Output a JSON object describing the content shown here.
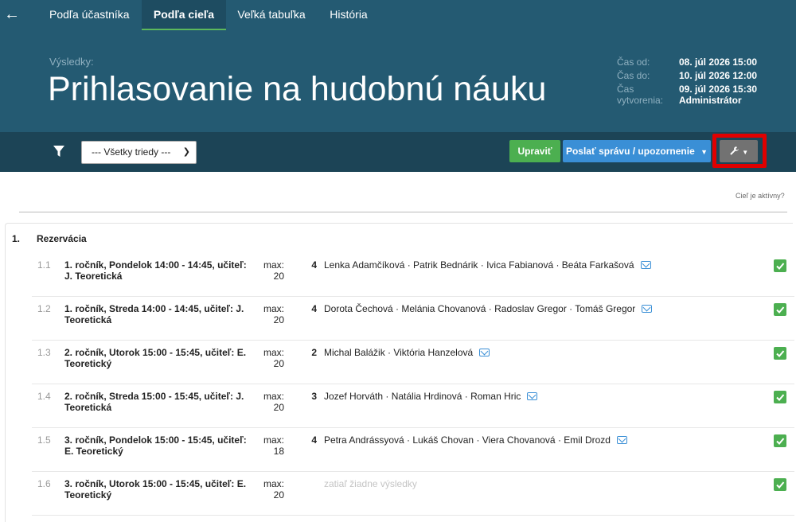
{
  "nav": {
    "back_icon": "arrow-left-icon",
    "tabs": [
      {
        "label": "Podľa účastníka"
      },
      {
        "label": "Podľa cieľa"
      },
      {
        "label": "Veľká tabuľka"
      },
      {
        "label": "História"
      }
    ]
  },
  "header": {
    "subtitle": "Výsledky:",
    "title": "Prihlasovanie na hudobnú náuku",
    "meta": {
      "from_label": "Čas od:",
      "from_value": "08. júl 2026 15:00",
      "to_label": "Čas do:",
      "to_value": "10. júl 2026 12:00",
      "created_label": "Čas vytvorenia:",
      "created_value": "09. júl 2026 15:30",
      "created_by": "Administrátor"
    }
  },
  "toolbar": {
    "filter_icon": "filter-icon",
    "class_select": "--- Všetky triedy ---",
    "edit_label": "Upraviť",
    "message_label": "Poslať správu / upozornenie",
    "tools_icon": "wrench-icon"
  },
  "main": {
    "active_link": "Cieľ je aktívny?",
    "section": {
      "num": "1.",
      "title": "Rezervácia"
    },
    "rows": [
      {
        "num": "1.1",
        "name": "1. ročník, Pondelok 14:00 - 14:45, učiteľ: J. Teoretická",
        "max_label": "max:",
        "max": "20",
        "count": "4",
        "people": "Lenka Adamčíková · Patrik Bednárik · Ivica Fabianová · Beáta Farkašová",
        "empty": ""
      },
      {
        "num": "1.2",
        "name": "1. ročník, Streda 14:00 - 14:45, učiteľ: J. Teoretická",
        "max_label": "max:",
        "max": "20",
        "count": "4",
        "people": "Dorota Čechová · Melánia Chovanová · Radoslav Gregor · Tomáš Gregor",
        "empty": ""
      },
      {
        "num": "1.3",
        "name": "2. ročník, Utorok 15:00 - 15:45, učiteľ: E. Teoretický",
        "max_label": "max:",
        "max": "20",
        "count": "2",
        "people": "Michal Balážik · Viktória Hanzelová",
        "empty": ""
      },
      {
        "num": "1.4",
        "name": "2. ročník, Streda 15:00 - 15:45, učiteľ: J. Teoretická",
        "max_label": "max:",
        "max": "20",
        "count": "3",
        "people": "Jozef Horváth · Natália Hrdinová · Roman Hric",
        "empty": ""
      },
      {
        "num": "1.5",
        "name": "3. ročník, Pondelok 15:00 - 15:45, učiteľ: E. Teoretický",
        "max_label": "max:",
        "max": "18",
        "count": "4",
        "people": "Petra Andrássyová · Lukáš Chovan · Viera Chovanová · Emil Drozd",
        "empty": ""
      },
      {
        "num": "1.6",
        "name": "3. ročník, Utorok 15:00 - 15:45, učiteľ: E. Teoretický",
        "max_label": "max:",
        "max": "20",
        "count": "",
        "people": "",
        "empty": "zatiaľ žiadne výsledky"
      }
    ]
  },
  "colors": {
    "header_bg": "#245a72",
    "toolbar_bg": "#1c4456",
    "green": "#4caf50",
    "blue": "#3a8fd6",
    "highlight": "#e00000"
  }
}
